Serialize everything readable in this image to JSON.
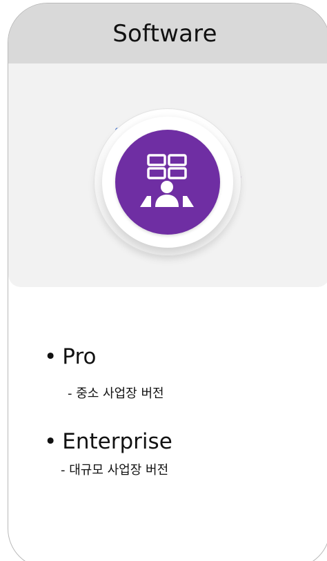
{
  "card": {
    "title": "Software",
    "icon": "video-wall-operator-icon",
    "colors": {
      "header_bg": "#d9d9d9",
      "panel_bg": "#f2f2f2",
      "accent_purple": "#6f2ea3",
      "accent_blue": "#1b56c9",
      "accent_teal": "#16b7b0"
    }
  },
  "items": [
    {
      "bullet": "•",
      "label": "Pro",
      "desc": "- 중소 사업장 버전"
    },
    {
      "bullet": "•",
      "label": "Enterprise",
      "desc": "- 대규모 사업장 버전"
    }
  ]
}
